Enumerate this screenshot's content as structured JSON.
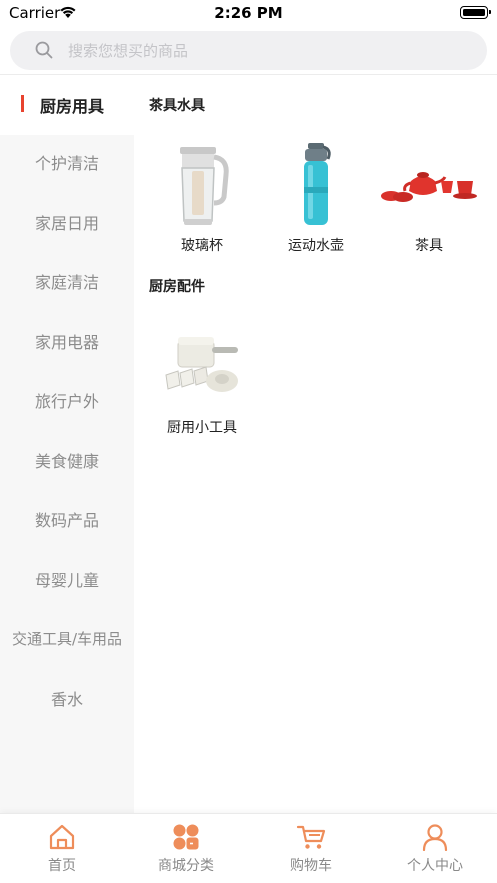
{
  "status_bar": {
    "carrier": "Carrier",
    "time": "2:26 PM"
  },
  "search": {
    "placeholder": "搜索您想买的商品"
  },
  "sidebar": {
    "items": [
      {
        "label": "厨房用具",
        "active": true
      },
      {
        "label": "个护清洁"
      },
      {
        "label": "家居日用"
      },
      {
        "label": "家庭清洁"
      },
      {
        "label": "家用电器"
      },
      {
        "label": "旅行户外"
      },
      {
        "label": "美食健康"
      },
      {
        "label": "数码产品"
      },
      {
        "label": "母婴儿童"
      },
      {
        "label": "交通工具/车用品"
      },
      {
        "label": "香水"
      }
    ]
  },
  "content": {
    "sections": [
      {
        "title": "茶具水具",
        "products": [
          {
            "name": "玻璃杯",
            "icon": "glass-teapot"
          },
          {
            "name": "运动水壶",
            "icon": "sport-bottle"
          },
          {
            "name": "茶具",
            "icon": "red-tea-set"
          }
        ]
      },
      {
        "title": "厨房配件",
        "products": [
          {
            "name": "厨用小工具",
            "icon": "grater-set"
          }
        ]
      }
    ]
  },
  "tabbar": {
    "items": [
      {
        "label": "首页",
        "icon": "home-icon"
      },
      {
        "label": "商城分类",
        "icon": "category-icon"
      },
      {
        "label": "购物车",
        "icon": "cart-icon"
      },
      {
        "label": "个人中心",
        "icon": "user-icon"
      }
    ]
  },
  "colors": {
    "accent": "#ee8d5a",
    "active_marker": "#e8432f",
    "sidebar_bg": "#f7f7f7"
  }
}
